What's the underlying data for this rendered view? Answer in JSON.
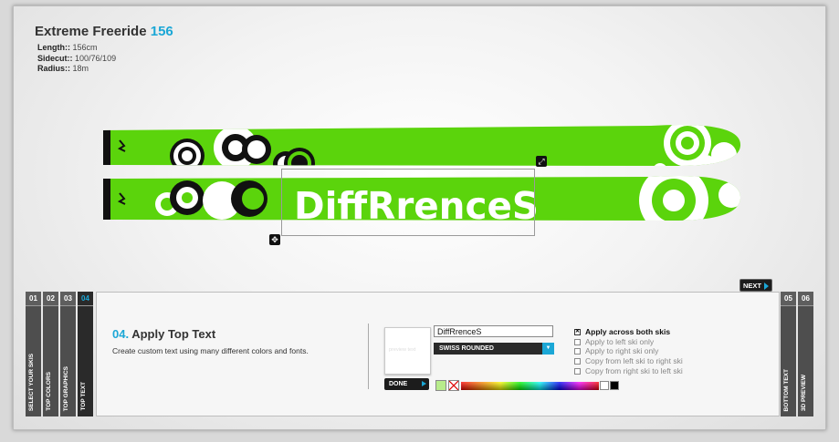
{
  "product": {
    "name": "Extreme Freeride",
    "size": "156"
  },
  "specs": [
    {
      "label": "Length::",
      "value": "156cm"
    },
    {
      "label": "Sidecut::",
      "value": "100/76/109"
    },
    {
      "label": "Radius::",
      "value": "18m"
    }
  ],
  "ski_text": "DiffRrenceS",
  "colors": {
    "ski_green": "#5bd40c",
    "accent": "#1ba7d6",
    "dark": "#1c1c1c",
    "selected_text_color": "#ffffff"
  },
  "icons": {
    "resize": "resize-icon",
    "move": "move-icon"
  },
  "next_label": "NEXT",
  "steps_left": [
    {
      "num": "01",
      "label": "SELECT YOUR SKIS"
    },
    {
      "num": "02",
      "label": "TOP COLORS"
    },
    {
      "num": "03",
      "label": "TOP GRAPHICS"
    },
    {
      "num": "04",
      "label": "TOP TEXT"
    }
  ],
  "steps_right": [
    {
      "num": "05",
      "label": "BOTTOM TEXT"
    },
    {
      "num": "06",
      "label": "3D PREVIEW"
    }
  ],
  "panel": {
    "step_num": "04.",
    "title": "Apply Top Text",
    "description": "Create custom text using many different colors and fonts.",
    "text_value": "DiffRrenceS",
    "preview_placeholder": "preview text",
    "font": "SWISS ROUNDED",
    "done_label": "DONE",
    "options": [
      {
        "label": "Apply across both skis",
        "checked": true
      },
      {
        "label": "Apply to left ski only",
        "checked": false
      },
      {
        "label": "Apply to right ski only",
        "checked": false
      },
      {
        "label": "Copy from left ski to right ski",
        "checked": false
      },
      {
        "label": "Copy from right ski to left ski",
        "checked": false
      }
    ]
  }
}
